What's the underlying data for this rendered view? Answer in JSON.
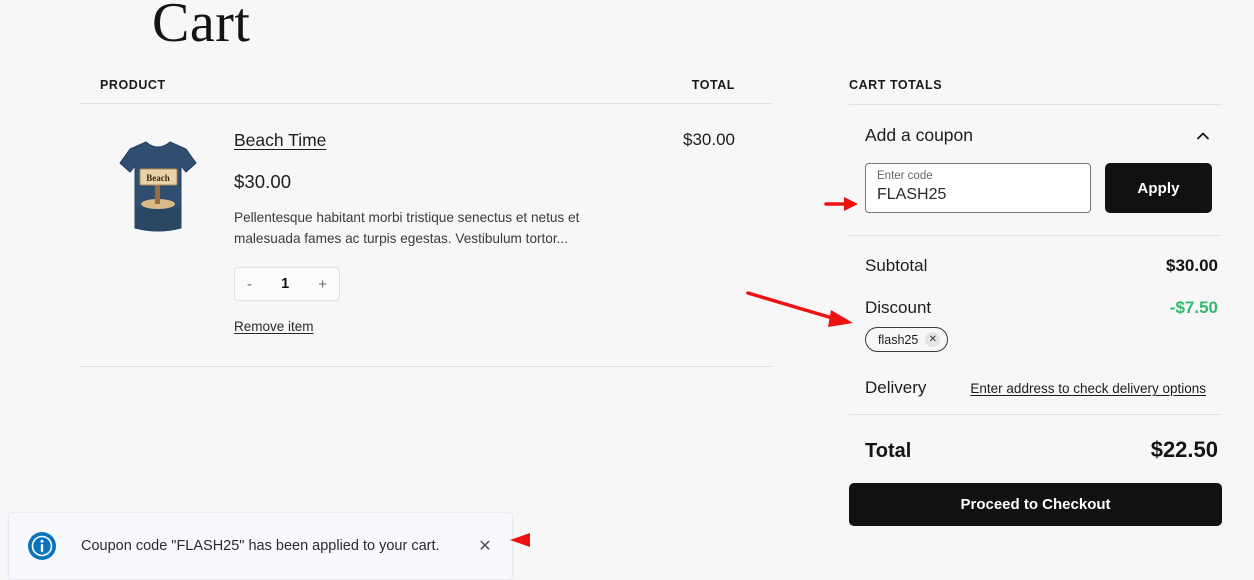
{
  "page": {
    "title": "Cart",
    "background_color": "#f7f7f7"
  },
  "product_table": {
    "headers": {
      "product": "PRODUCT",
      "total": "TOTAL"
    },
    "rows": [
      {
        "name": "Beach Time",
        "price": "$30.00",
        "description": "Pellentesque habitant morbi tristique senectus et netus et malesuada fames ac turpis egestas. Vestibulum tortor...",
        "quantity": "1",
        "decrease_label": "-",
        "increase_label": "+",
        "remove_label": "Remove item",
        "line_total": "$30.00",
        "thumbnail": "tshirt-beach-time-thumbnail"
      }
    ]
  },
  "cart_totals": {
    "heading": "CART TOTALS",
    "coupon": {
      "title": "Add a coupon",
      "toggle_icon": "chevron-up-icon",
      "input_label": "Enter code",
      "input_value": "FLASH25",
      "input_placeholder": "Enter code",
      "apply_label": "Apply"
    },
    "subtotal": {
      "label": "Subtotal",
      "value": "$30.00"
    },
    "discount": {
      "label": "Discount",
      "value": "-$7.50",
      "color": "#2fb96a",
      "chip_label": "flash25",
      "chip_remove_icon": "close-icon"
    },
    "delivery": {
      "label": "Delivery",
      "link_text": "Enter address to check delivery options"
    },
    "total": {
      "label": "Total",
      "value": "$22.50"
    },
    "checkout_label": "Proceed to Checkout"
  },
  "toast": {
    "icon": "info-circle-icon",
    "message": "Coupon code \"FLASH25\" has been applied to your cart.",
    "close_icon": "close-icon",
    "icon_color": "#0b74bd",
    "background_color": "#f8f9fd"
  },
  "annotations": {
    "color": "#ee1111",
    "arrows": [
      {
        "name": "arrow-pointing-to-coupon-input",
        "direction": "right"
      },
      {
        "name": "arrow-pointing-to-discount-row",
        "direction": "down-right"
      },
      {
        "name": "arrow-pointing-to-toast-close",
        "direction": "left"
      }
    ]
  }
}
